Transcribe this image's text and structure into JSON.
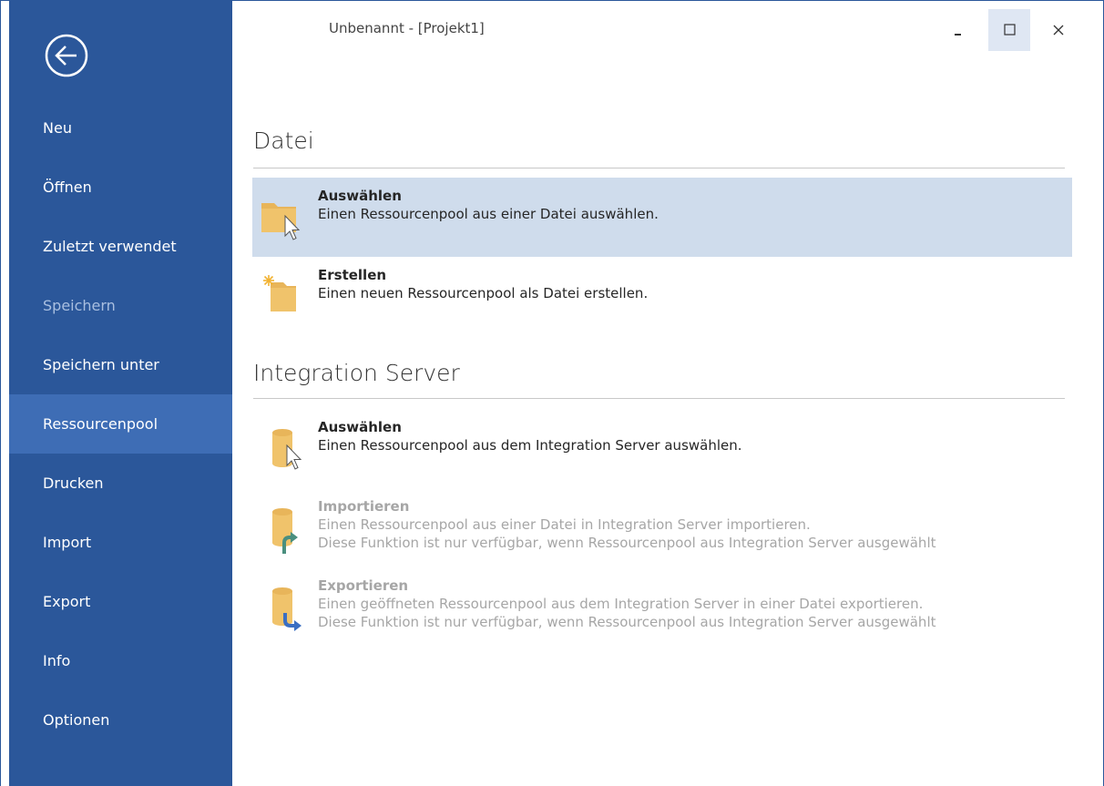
{
  "window": {
    "title": "Unbenannt - [Projekt1]",
    "minimize_label": "minimize",
    "maximize_label": "maximize",
    "close_label": "close"
  },
  "sidebar": {
    "back_label": "back",
    "items": [
      {
        "label": "Neu",
        "state": "normal"
      },
      {
        "label": "Öffnen",
        "state": "normal"
      },
      {
        "label": "Zuletzt verwendet",
        "state": "normal"
      },
      {
        "label": "Speichern",
        "state": "disabled"
      },
      {
        "label": "Speichern unter",
        "state": "normal"
      },
      {
        "label": "Ressourcenpool",
        "state": "selected"
      },
      {
        "label": "Drucken",
        "state": "normal"
      },
      {
        "label": "Import",
        "state": "normal"
      },
      {
        "label": "Export",
        "state": "normal"
      },
      {
        "label": "Info",
        "state": "normal"
      },
      {
        "label": "Optionen",
        "state": "normal"
      }
    ]
  },
  "main": {
    "sections": [
      {
        "title": "Datei",
        "actions": [
          {
            "heading": "Auswählen",
            "desc1": "Einen Ressourcenpool aus einer Datei auswählen.",
            "desc2": ""
          },
          {
            "heading": "Erstellen",
            "desc1": "Einen neuen Ressourcenpool als Datei erstellen.",
            "desc2": ""
          }
        ]
      },
      {
        "title": "Integration Server",
        "actions": [
          {
            "heading": "Auswählen",
            "desc1": "Einen Ressourcenpool aus dem Integration Server auswählen.",
            "desc2": ""
          },
          {
            "heading": "Importieren",
            "desc1": "Einen Ressourcenpool aus einer Datei in Integration Server importieren.",
            "desc2": "Diese Funktion ist nur verfügbar, wenn Ressourcenpool aus Integration Server ausgewählt"
          },
          {
            "heading": "Exportieren",
            "desc1": "Einen geöffneten Ressourcenpool aus dem Integration Server in einer Datei exportieren.",
            "desc2": "Diese Funktion ist nur verfügbar, wenn Ressourcenpool aus Integration Server ausgewählt"
          }
        ]
      }
    ]
  },
  "colors": {
    "sidebar_bg": "#2b579a",
    "sidebar_selected": "#3e6db5",
    "highlight_bg": "#cfdcec",
    "folder": "#e8b55a",
    "disabled_text": "#a6a6a6"
  },
  "icons": [
    "back-arrow-icon",
    "folder-select-icon",
    "folder-new-icon",
    "database-select-icon",
    "database-import-icon",
    "database-export-icon"
  ]
}
